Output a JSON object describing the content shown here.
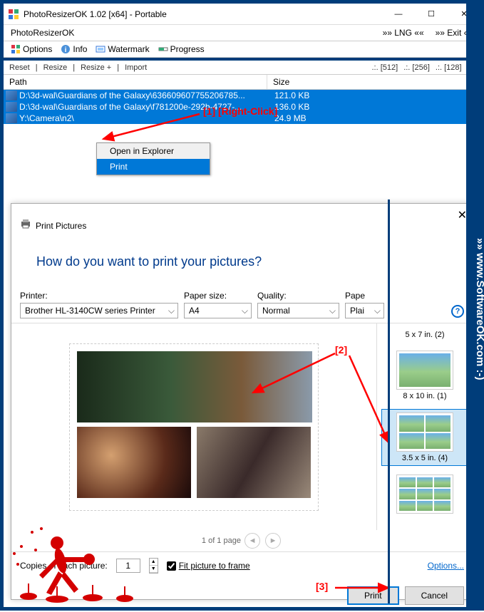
{
  "window": {
    "title": "PhotoResizerOK 1.02 [x64] - Portable",
    "subtitle": "PhotoResizerOK",
    "lng": "»» LNG ««",
    "exit": "»» Exit ««"
  },
  "toolbar": {
    "options": "Options",
    "info": "Info",
    "watermark": "Watermark",
    "progress": "Progress"
  },
  "midbar": {
    "reset": "Reset",
    "resize": "Resize",
    "resize_plus": "Resize +",
    "import": "Import",
    "s512": ".:. [512]",
    "s256": ".:. [256]",
    "s128": ".:. [128]"
  },
  "list": {
    "col_path": "Path",
    "col_size": "Size",
    "rows": [
      {
        "path": "D:\\3d-wal\\Guardians of the Galaxy\\636609607755206785...",
        "size": "121.0 KB"
      },
      {
        "path": "D:\\3d-wal\\Guardians of the Galaxy\\f781200e-292b-4727-...",
        "size": "136.0 KB"
      },
      {
        "path": "Y:\\Camera\\n2\\",
        "size": "24.9 MB"
      }
    ]
  },
  "context_menu": {
    "open": "Open in Explorer",
    "print": "Print"
  },
  "annotations": {
    "a1": "[1]",
    "a1b": "[Right-Click]",
    "a2": "[2]",
    "a3": "[3]"
  },
  "print_dialog": {
    "title": "Print Pictures",
    "heading": "How do you want to print your pictures?",
    "printer_label": "Printer:",
    "printer_value": "Brother HL-3140CW series Printer",
    "paper_label": "Paper size:",
    "paper_value": "A4",
    "quality_label": "Quality:",
    "quality_value": "Normal",
    "papertype_label": "Pape",
    "papertype_value": "Plai",
    "layout1": "5 x 7 in. (2)",
    "layout2": "8 x 10 in. (1)",
    "layout3": "3.5 x 5 in. (4)",
    "pager": "1 of 1 page",
    "copies_label": "Copies of each picture:",
    "copies_value": "1",
    "fit_label": "Fit picture to frame",
    "options_link": "Options...",
    "print_btn": "Print",
    "cancel_btn": "Cancel"
  },
  "watermark": "»»  www.SoftwareOK.com  :-)"
}
